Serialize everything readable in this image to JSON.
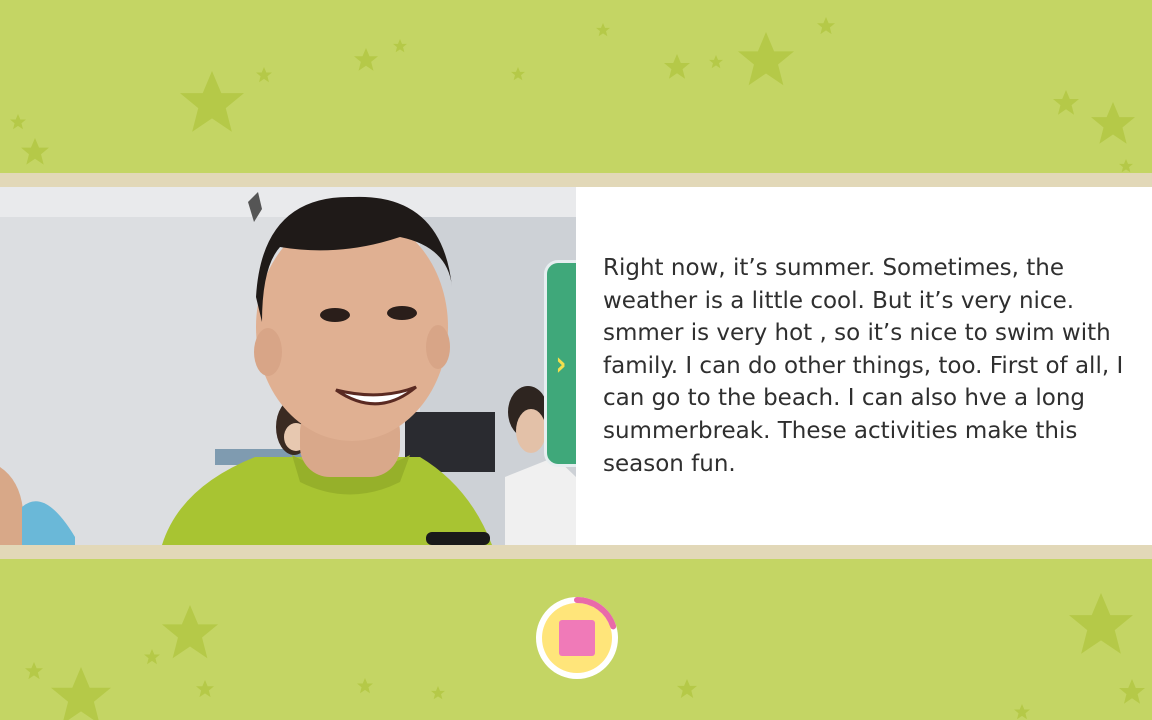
{
  "colors": {
    "background": "#c4d564",
    "stars": "#b5c948",
    "band": "#e2d8b8",
    "nav_tab": "#3fa87a",
    "nav_chevron": "#f2df4e",
    "record_ring": "#ffe57a",
    "record_progress": "#e96aa9",
    "stop_square": "#f07ab8"
  },
  "photo": {
    "description_icon": "student-selfie-photo"
  },
  "nav_tab": {
    "icon": "chevron-right-icon",
    "glyph": "›"
  },
  "story": {
    "text": "Right now, it’s summer. Sometimes, the weather is a little cool. But it’s very nice. smmer is very hot , so it’s nice to swim with family. I can do other things, too. First of all, I can go to the beach. I can also hve a long summerbreak. These activities make this season fun."
  },
  "record_button": {
    "icon": "stop-icon",
    "progress": 0.2
  }
}
